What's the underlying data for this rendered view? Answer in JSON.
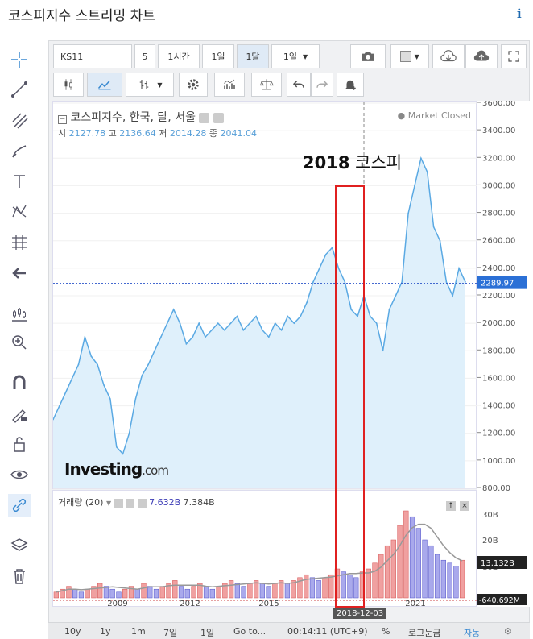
{
  "page_title": "코스피지수 스트리밍 차트",
  "info_icon": "i",
  "toolbar": {
    "symbol": "KS11",
    "interval_num": "5",
    "btn_1h": "1시간",
    "btn_1d": "1일",
    "btn_1m": "1달",
    "btn_dropdown": "1일"
  },
  "legend": {
    "name": "코스피지수, 한국, 달, 서울",
    "open_label": "시",
    "open": "2127.78",
    "high_label": "고",
    "high": "2136.64",
    "low_label": "저",
    "low": "2014.28",
    "close_label": "종",
    "close": "2041.04",
    "status": "Market Closed"
  },
  "annotation": {
    "text_year": "2018",
    "text_name": "코스피"
  },
  "watermark": {
    "brand": "Investing",
    "suffix": ".com"
  },
  "volume": {
    "label": "거래량 (20)",
    "v1": "7.632B",
    "v2": "7.384B",
    "current": "13.132B",
    "min": "-640.692M"
  },
  "price_axis": {
    "ticks": [
      "3600.00",
      "3400.00",
      "3200.00",
      "3000.00",
      "2800.00",
      "2600.00",
      "2400.00",
      "2200.00",
      "2000.00",
      "1800.00",
      "1600.00",
      "1400.00",
      "1200.00",
      "1000.00",
      "800.00"
    ],
    "current": "2289.97"
  },
  "vol_axis": {
    "ticks": [
      "30B",
      "20B",
      "10B"
    ]
  },
  "time_axis": {
    "ticks": [
      "2009",
      "2012",
      "2015",
      "2021"
    ],
    "crosshair_label": "2018-12-03"
  },
  "bottom": {
    "b_10y": "10y",
    "b_1y": "1y",
    "b_1m": "1m",
    "b_7d": "7일",
    "b_1d": "1일",
    "goto": "Go to...",
    "time": "00:14:11 (UTC+9)",
    "pct": "%",
    "log": "로그눈금",
    "auto": "자동"
  },
  "chart_data": {
    "type": "area",
    "x_range": [
      "2007",
      "2022"
    ],
    "ylim": [
      800,
      3600
    ],
    "y": [
      1300,
      1400,
      1500,
      1600,
      1700,
      1900,
      1760,
      1700,
      1550,
      1450,
      1100,
      1050,
      1200,
      1450,
      1620,
      1700,
      1800,
      1900,
      2000,
      2100,
      2000,
      1850,
      1900,
      2000,
      1900,
      1950,
      2000,
      1950,
      2000,
      2050,
      1950,
      2000,
      2050,
      1950,
      1900,
      2000,
      1950,
      2050,
      2000,
      2050,
      2150,
      2300,
      2400,
      2500,
      2550,
      2400,
      2300,
      2100,
      2050,
      2200,
      2050,
      2000,
      1800,
      2100,
      2200,
      2300,
      2800,
      3000,
      3200,
      3100,
      2700,
      2600,
      2300,
      2200,
      2400,
      2300
    ],
    "volume_values": [
      2,
      3,
      4,
      3,
      2,
      3,
      4,
      5,
      4,
      3,
      2,
      3,
      4,
      3,
      5,
      4,
      3,
      4,
      5,
      6,
      4,
      3,
      4,
      5,
      4,
      3,
      4,
      5,
      6,
      5,
      4,
      5,
      6,
      5,
      4,
      5,
      6,
      5,
      6,
      7,
      8,
      7,
      6,
      7,
      8,
      10,
      9,
      8,
      7,
      9,
      10,
      12,
      15,
      18,
      20,
      25,
      30,
      28,
      24,
      20,
      18,
      15,
      13,
      12,
      11,
      13
    ]
  }
}
